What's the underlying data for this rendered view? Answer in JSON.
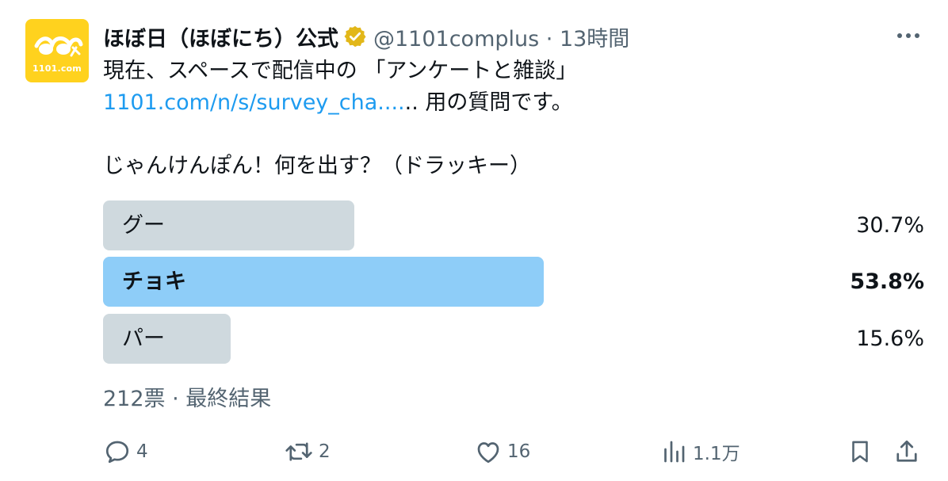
{
  "avatar": {
    "logo_text": "1101.com"
  },
  "header": {
    "display_name": "ほぼ日（ほぼにち）公式",
    "handle_time": "@1101complus · 13時間"
  },
  "tweet": {
    "line1": "現在、スペースで配信中の 「アンケートと雑談」",
    "link_text": "1101.com/n/s/survey_cha....",
    "line2_rest": ".. 用の質問です。",
    "question": "じゃんけんぽん！何を出す？（ドラッキー）"
  },
  "poll": {
    "options": [
      {
        "label": "グー",
        "percent": "30.7%",
        "fraction": 0.307
      },
      {
        "label": "チョキ",
        "percent": "53.8%",
        "fraction": 0.538
      },
      {
        "label": "パー",
        "percent": "15.6%",
        "fraction": 0.156
      }
    ],
    "meta": "212票 · 最終結果"
  },
  "actions": {
    "reply_count": "4",
    "retweet_count": "2",
    "like_count": "16",
    "views_count": "1.1万"
  },
  "colors": {
    "link": "#1d9bf0",
    "winner_bar": "#8ecdf8",
    "option_bar": "#cfd9de",
    "verified_badge": "#e2b719",
    "avatar_bg": "#ffd21e"
  }
}
